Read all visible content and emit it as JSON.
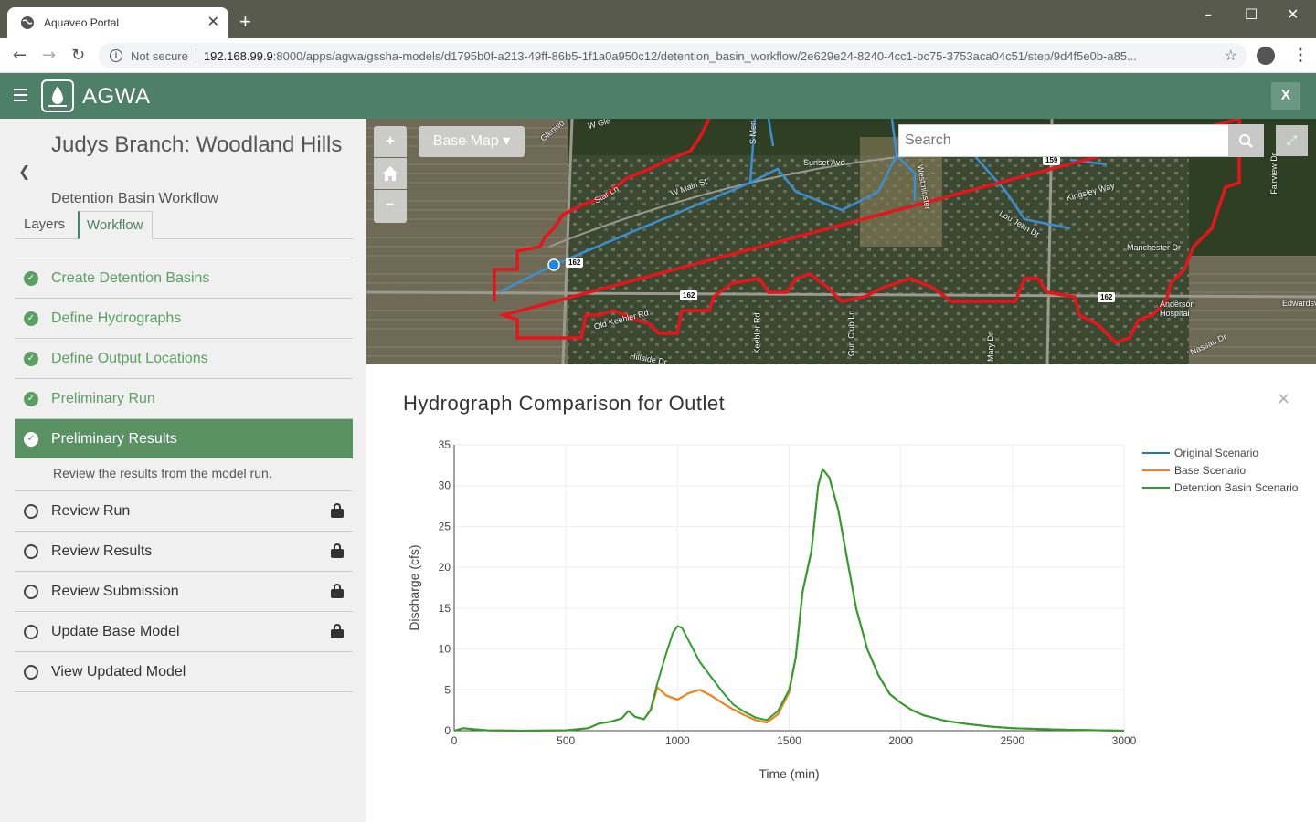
{
  "browser": {
    "tab_title": "Aquaveo Portal",
    "tab_close": "✕",
    "new_tab": "+",
    "security": "Not secure",
    "url_host": "192.168.99.9",
    "url_rest": ":8000/apps/agwa/gssha-models/d1795b0f-a213-49ff-86b5-1f1a0a950c12/detention_basin_workflow/2e629e24-8240-4cc1-bc75-3753aca04c51/step/9d4f5e0b-a85...",
    "minimize": "–",
    "maximize": "☐",
    "close": "✕"
  },
  "header": {
    "app_name": "AGWA",
    "close_label": "X"
  },
  "sidebar": {
    "project_title": "Judys Branch: Woodland Hills",
    "workflow_name": "Detention Basin Workflow",
    "tabs": [
      {
        "label": "Layers"
      },
      {
        "label": "Workflow"
      }
    ],
    "steps": [
      {
        "label": "Create Detention Basins",
        "state": "done"
      },
      {
        "label": "Define Hydrographs",
        "state": "done"
      },
      {
        "label": "Define Output Locations",
        "state": "done"
      },
      {
        "label": "Preliminary Run",
        "state": "done"
      },
      {
        "label": "Preliminary Results",
        "state": "active"
      },
      {
        "label": "Review Run",
        "state": "locked"
      },
      {
        "label": "Review Results",
        "state": "locked"
      },
      {
        "label": "Review Submission",
        "state": "locked"
      },
      {
        "label": "Update Base Model",
        "state": "locked"
      },
      {
        "label": "View Updated Model",
        "state": "open"
      }
    ],
    "active_description": "Review the results from the model run."
  },
  "map": {
    "zoom_in": "+",
    "zoom_out": "−",
    "basemap_label": "Base Map ▾",
    "search_placeholder": "Search",
    "labels": [
      {
        "text": "Glenwo",
        "cls": "l1"
      },
      {
        "text": "W Gle",
        "cls": "l2"
      },
      {
        "text": "S Meri",
        "cls": "l3"
      },
      {
        "text": "Sunset Ave",
        "cls": "l4"
      },
      {
        "text": "Westminster",
        "cls": "l5"
      },
      {
        "text": "Star Ln",
        "cls": "l6"
      },
      {
        "text": "W Main St",
        "cls": "l7"
      },
      {
        "text": "Kingsley Way",
        "cls": "l8"
      },
      {
        "text": "Lou Jean Dr",
        "cls": "l9"
      },
      {
        "text": "Manchester Dr",
        "cls": "l10"
      },
      {
        "text": "Fairview Dr",
        "cls": "l11"
      },
      {
        "text": "Old Keebler Rd",
        "cls": "l12"
      },
      {
        "text": "Keebler Rd",
        "cls": "l13"
      },
      {
        "text": "Gun Club Ln",
        "cls": "l14"
      },
      {
        "text": "Mary Dr",
        "cls": "l15"
      },
      {
        "text": "Anderson Hospital",
        "cls": "l16"
      },
      {
        "text": "Edwardsv",
        "cls": "l17"
      },
      {
        "text": "Nassau Dr",
        "cls": "l18"
      },
      {
        "text": "Hillside Dr",
        "cls": "l19"
      }
    ],
    "shields": [
      "162",
      "162",
      "162",
      "159"
    ]
  },
  "chart_panel": {
    "title": "Hydrograph Comparison for Outlet",
    "close": "×"
  },
  "chart_data": {
    "type": "line",
    "xlabel": "Time (min)",
    "ylabel": "Discharge (cfs)",
    "xlim": [
      0,
      3000
    ],
    "ylim": [
      0,
      35
    ],
    "xticks": [
      0,
      500,
      1000,
      1500,
      2000,
      2500,
      3000
    ],
    "yticks": [
      0,
      5,
      10,
      15,
      20,
      25,
      30,
      35
    ],
    "grid": true,
    "legend_position": "top-right",
    "colors": {
      "Original Scenario": "#1f77b4",
      "Base Scenario": "#ff7f0e",
      "Detention Basin Scenario": "#2ca02c"
    },
    "series": [
      {
        "name": "Original Scenario",
        "x": [
          0,
          40,
          80,
          150,
          300,
          500,
          600,
          650,
          700,
          750,
          780,
          810,
          850,
          880,
          910,
          950,
          1000,
          1050,
          1100,
          1150,
          1200,
          1250,
          1300,
          1350,
          1400,
          1450,
          1500,
          1530,
          1560,
          1600,
          1630,
          1650,
          1680,
          1720,
          1760,
          1800,
          1850,
          1900,
          1950,
          2000,
          2050,
          2100,
          2200,
          2300,
          2400,
          2500,
          2700,
          3000
        ],
        "y": [
          0,
          0.3,
          0.2,
          0.05,
          0,
          0.05,
          0.3,
          0.9,
          1.1,
          1.5,
          2.4,
          1.7,
          1.4,
          2.5,
          5.3,
          4.3,
          3.8,
          4.6,
          5.0,
          4.3,
          3.4,
          2.6,
          1.9,
          1.3,
          1.0,
          2.0,
          4.7,
          9.0,
          17.0,
          22.0,
          30.0,
          32.0,
          31.0,
          27.0,
          21.0,
          15.0,
          10.0,
          6.8,
          4.5,
          3.4,
          2.5,
          1.9,
          1.2,
          0.8,
          0.5,
          0.3,
          0.15,
          0
        ]
      },
      {
        "name": "Base Scenario",
        "x": [
          0,
          40,
          80,
          150,
          300,
          500,
          600,
          650,
          700,
          750,
          780,
          810,
          850,
          880,
          910,
          950,
          1000,
          1050,
          1100,
          1150,
          1200,
          1250,
          1300,
          1350,
          1400,
          1450,
          1500,
          1530,
          1560,
          1600,
          1630,
          1650,
          1680,
          1720,
          1760,
          1800,
          1850,
          1900,
          1950,
          2000,
          2050,
          2100,
          2200,
          2300,
          2400,
          2500,
          2700,
          3000
        ],
        "y": [
          0,
          0.3,
          0.2,
          0.05,
          0,
          0.05,
          0.3,
          0.9,
          1.1,
          1.5,
          2.4,
          1.7,
          1.4,
          2.5,
          5.3,
          4.3,
          3.8,
          4.6,
          5.0,
          4.3,
          3.4,
          2.6,
          1.9,
          1.3,
          1.0,
          2.0,
          4.7,
          9.0,
          17.0,
          22.0,
          30.0,
          32.0,
          31.0,
          27.0,
          21.0,
          15.0,
          10.0,
          6.8,
          4.5,
          3.4,
          2.5,
          1.9,
          1.2,
          0.8,
          0.5,
          0.3,
          0.15,
          0
        ]
      },
      {
        "name": "Detention Basin Scenario",
        "x": [
          0,
          40,
          80,
          150,
          300,
          500,
          600,
          650,
          700,
          750,
          780,
          810,
          850,
          880,
          910,
          950,
          980,
          1000,
          1020,
          1050,
          1100,
          1150,
          1200,
          1250,
          1300,
          1350,
          1400,
          1450,
          1500,
          1530,
          1560,
          1600,
          1630,
          1650,
          1680,
          1720,
          1760,
          1800,
          1850,
          1900,
          1950,
          2000,
          2050,
          2100,
          2200,
          2300,
          2400,
          2500,
          2700,
          3000
        ],
        "y": [
          0,
          0.3,
          0.2,
          0.05,
          0,
          0.05,
          0.3,
          0.9,
          1.1,
          1.5,
          2.4,
          1.7,
          1.4,
          2.6,
          5.8,
          9.5,
          12.0,
          12.8,
          12.6,
          11.0,
          8.4,
          6.6,
          4.8,
          3.2,
          2.3,
          1.6,
          1.3,
          2.4,
          5.0,
          9.0,
          17.0,
          22.0,
          30.0,
          32.0,
          31.0,
          27.0,
          21.0,
          15.0,
          10.0,
          6.8,
          4.5,
          3.4,
          2.5,
          1.9,
          1.2,
          0.8,
          0.5,
          0.3,
          0.15,
          0
        ]
      }
    ]
  }
}
